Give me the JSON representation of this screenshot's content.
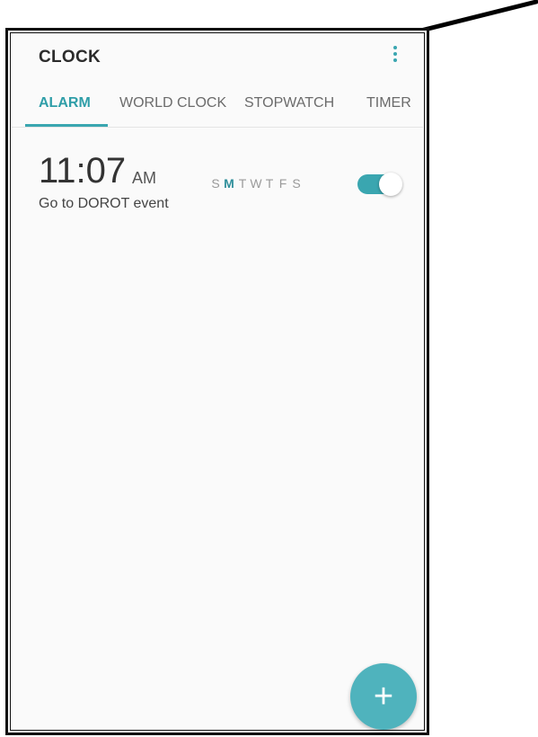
{
  "app": {
    "title": "CLOCK",
    "more_icon": "more-vert-icon"
  },
  "tabs": [
    {
      "label": "ALARM",
      "active": true
    },
    {
      "label": "WORLD CLOCK",
      "active": false
    },
    {
      "label": "STOPWATCH",
      "active": false
    },
    {
      "label": "TIMER",
      "active": false
    }
  ],
  "alarm": {
    "time": "11:07",
    "ampm": "AM",
    "label": "Go to DOROT event",
    "days": [
      "S",
      "M",
      "T",
      "W",
      "T",
      "F",
      "S"
    ],
    "active_days": [
      1
    ],
    "enabled": true
  },
  "fab": {
    "label": "+",
    "icon": "plus-icon"
  },
  "colors": {
    "accent": "#3aa6b0",
    "fab": "#4fb3bd"
  }
}
